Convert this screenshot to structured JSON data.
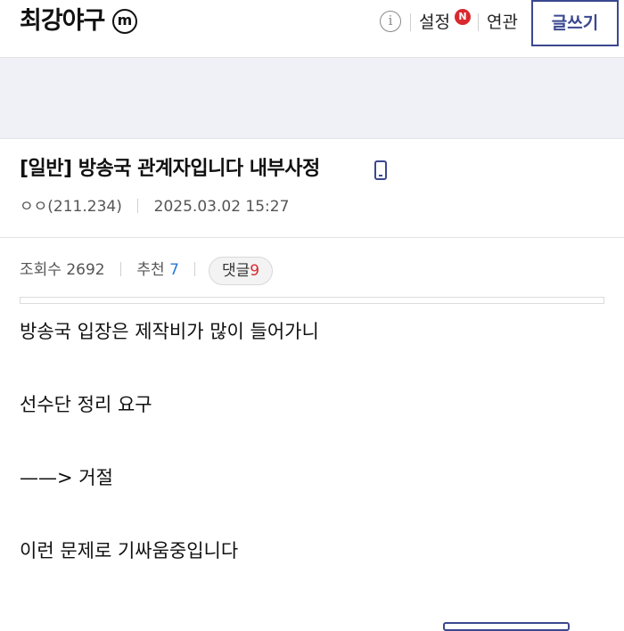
{
  "header": {
    "gallery_name": "최강야구",
    "minor_badge": "m",
    "info_icon_glyph": "i",
    "settings_label": "설정",
    "new_badge": "N",
    "related_label": "연관",
    "write_label": "글쓰기"
  },
  "post": {
    "title": "[일반] 방송국 관계자입니다 내부사정",
    "author": "ㅇㅇ(211.234)",
    "datetime": "2025.03.02 15:27",
    "views_label": "조회수 2692",
    "recommend_label": "추천",
    "recommend_count": "7",
    "comments_label": "댓글",
    "comments_count": "9",
    "body": [
      "방송국 입장은 제작비가 많이 들어가니",
      "선수단 정리 요구",
      "——> 거절",
      "이런 문제로 기싸움중입니다"
    ]
  },
  "colors": {
    "accent": "#3b4890",
    "badge_red": "#d8292f",
    "recommend_blue": "#2a7ad8",
    "banner_bg": "#eff1f6"
  },
  "icons": [
    "minor-gallery-badge-icon",
    "info-icon",
    "mobile-icon"
  ]
}
